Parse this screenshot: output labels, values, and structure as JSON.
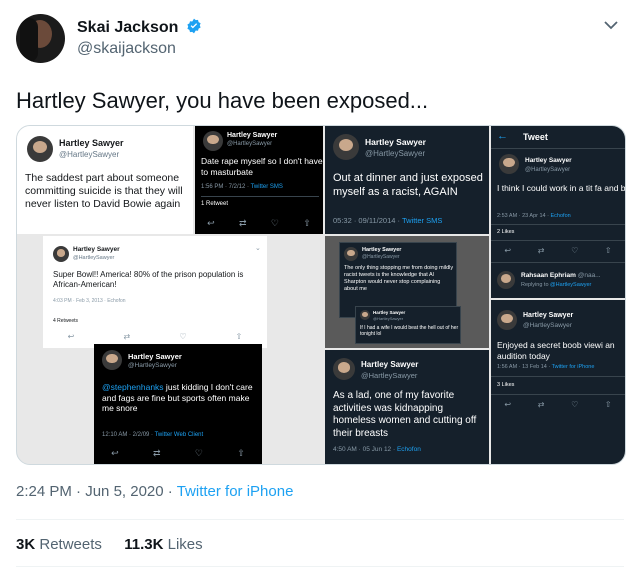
{
  "tweet": {
    "display_name": "Skai Jackson",
    "handle": "@skaijackson",
    "text": "Hartley Sawyer, you have been exposed...",
    "time": "2:24 PM",
    "date": "Jun 5, 2020",
    "separator": "·",
    "source": "Twitter for iPhone",
    "retweets_count": "3K",
    "retweets_label": "Retweets",
    "likes_count": "11.3K",
    "likes_label": "Likes"
  },
  "colors": {
    "link": "#1da1f2",
    "verified": "#1da1f2",
    "dark_bg": "#15202b"
  },
  "icons": [
    "verified-icon",
    "chevron-down-icon",
    "reply-icon",
    "retweet-icon",
    "like-icon",
    "share-icon",
    "back-arrow-icon"
  ],
  "screenshots": {
    "name": "Hartley Sawyer",
    "handle": "@HartleySawyer",
    "p1": {
      "text": "The saddest part about someone committing suicide is that they will never listen to David Bowie again"
    },
    "p2": {
      "text": "Date rape myself so I don't have to masturbate",
      "meta": "1:56 PM · 7/2/12 · ",
      "source": "Twitter SMS",
      "stat": "1 Retweet"
    },
    "p3": {
      "text": "Super Bowl!! America! 80% of the prison population is African-American!",
      "meta": "4:03 PM · Feb 3, 2013 · Echofon",
      "stat": "4 Retweets"
    },
    "p4": {
      "mention": "@stephenhanks",
      "text": " just kidding I don't care and fags are fine but sports often make me snore",
      "meta": "12:10 AM · 2/2/09 · ",
      "source": "Twitter Web Client"
    },
    "p5": {
      "text": "Out at dinner and just exposed myself as a racist, AGAIN",
      "meta": "05:32 · 09/11/2014 · ",
      "source": "Twitter SMS"
    },
    "p6": {
      "text": "The only thing stopping me from doing mildly racist tweets is the knowledge that Al Sharpton would never stop complaining about me",
      "text2": "If I had a wife I would beat the hell out of her tonight lol"
    },
    "p7": {
      "text": "As a lad, one of my favorite activities was kidnapping homeless women and cutting off their breasts",
      "meta": "4:50 AM · 05 Jun 12 · ",
      "source": "Echofon"
    },
    "p8": {
      "header": "Tweet",
      "text": "I think I could work in a tit fa and be pretty happy",
      "meta": "2:53 AM · 23 Apr 14 · ",
      "source": "Echofon",
      "stat": "2 Likes",
      "reply_name": "Rahsaan Ephriam",
      "reply_handle": "@naa...",
      "reply_to": "Replying to ",
      "reply_to_handle": "@HartleySawyer"
    },
    "p9": {
      "text": "Enjoyed a secret boob viewi an audition today",
      "meta": "1:56 AM · 13 Feb 14 · ",
      "source": "Twitter for iPhone",
      "stat": "3 Likes"
    }
  }
}
